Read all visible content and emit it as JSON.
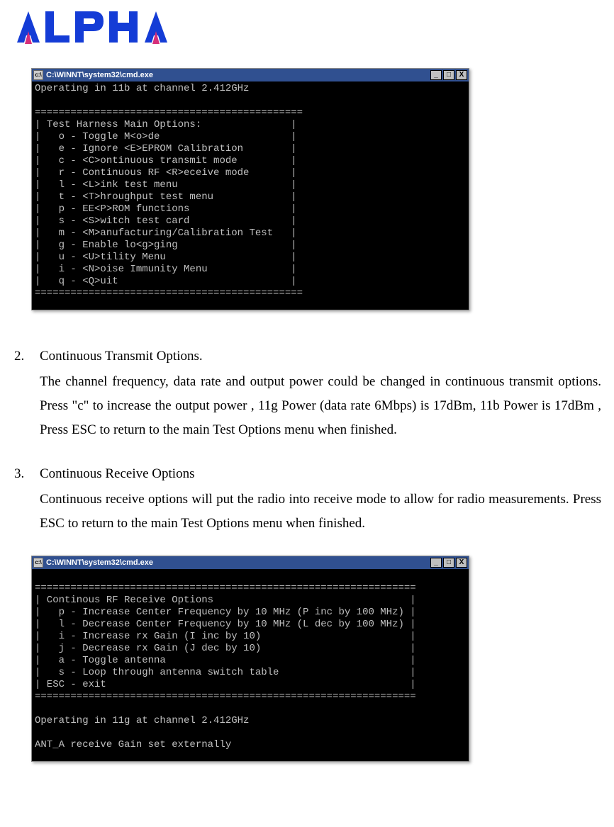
{
  "logo": {
    "text": "ALPHA"
  },
  "cmd1": {
    "title": "C:\\WINNT\\system32\\cmd.exe",
    "content": "Operating in 11b at channel 2.412GHz\n\n=============================================\n| Test Harness Main Options:               |\n|   o - Toggle M<o>de                      |\n|   e - Ignore <E>EPROM Calibration        |\n|   c - <C>ontinuous transmit mode         |\n|   r - Continuous RF <R>eceive mode       |\n|   l - <L>ink test menu                   |\n|   t - <T>hroughput test menu             |\n|   p - EE<P>ROM functions                 |\n|   s - <S>witch test card                 |\n|   m - <M>anufacturing/Calibration Test   |\n|   g - Enable lo<g>ging                   |\n|   u - <U>tility Menu                     |\n|   i - <N>oise Immunity Menu              |\n|   q - <Q>uit                             |\n============================================="
  },
  "section2": {
    "number": "2.",
    "title": "Continuous Transmit Options.",
    "body": "The channel frequency, data rate and output power could be changed in continuous transmit options. Press \"c\" to increase the output power , 11g Power (data rate 6Mbps) is 17dBm, 11b Power is 17dBm , Press ESC to return to the main Test Options menu when finished."
  },
  "section3": {
    "number": "3.",
    "title": "Continuous Receive Options",
    "body": "Continuous receive options will put the radio into receive mode to allow for radio measurements. Press ESC to return to the main Test Options menu when finished."
  },
  "cmd2": {
    "title": "C:\\WINNT\\system32\\cmd.exe",
    "content": "\n================================================================\n| Continous RF Receive Options                                 |\n|   p - Increase Center Frequency by 10 MHz (P inc by 100 MHz) |\n|   l - Decrease Center Frequency by 10 MHz (L dec by 100 MHz) |\n|   i - Increase rx Gain (I inc by 10)                         |\n|   j - Decrease rx Gain (J dec by 10)                         |\n|   a - Toggle antenna                                         |\n|   s - Loop through antenna switch table                      |\n| ESC - exit                                                   |\n================================================================\n\nOperating in 11g at channel 2.412GHz\n\nANT_A receive Gain set externally"
  },
  "win_buttons": {
    "min": "_",
    "max": "□",
    "close": "X"
  }
}
